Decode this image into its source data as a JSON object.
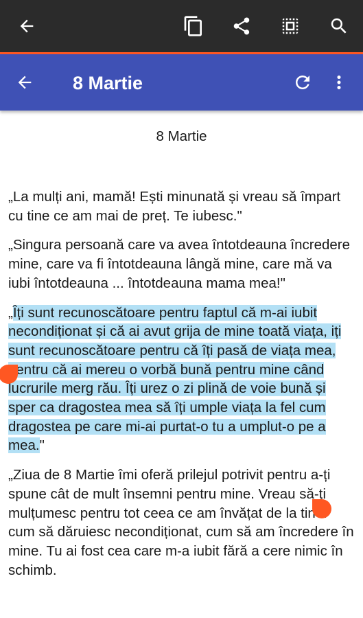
{
  "action_mode": {
    "back_icon": "arrow-back-icon",
    "actions": [
      {
        "name": "copy-icon"
      },
      {
        "name": "share-icon"
      },
      {
        "name": "select-all-icon"
      },
      {
        "name": "web-search-icon"
      }
    ]
  },
  "app_bar": {
    "title": "8 Martie",
    "back_icon": "arrow-back-icon",
    "refresh_icon": "refresh-icon",
    "menu_icon": "more-vert-icon",
    "color": "#3f51b5"
  },
  "content": {
    "title": "8 Martie",
    "p1": "„La mulți ani, mamă! Ești minunată și vreau să împart cu tine ce am mai de preț. Te iubesc.\"",
    "p2": "„Singura persoană care va avea întotdeauna încredere mine, care va fi întotdeauna lângă mine, care mă va iubi întotdeauna ... întotdeauna mama mea!\"",
    "p3_lead": "„",
    "p3_selected": "Îți sunt recunoscătoare pentru faptul că m-ai iubit necondiționat și că ai avut grija de mine toată viața, iți sunt recunoscătoare pentru că îți pasă de viața mea, pentru că ai mereu o vorbă bună pentru mine când lucrurile merg rău. Îți urez o zi plină de voie bună și sper ca dragostea mea să îți umple viața la fel cum dragostea pe care mi-ai purtat-o tu a umplut-o pe a mea.",
    "p3_tail": "\"",
    "p4": "„Ziua de 8 Martie îmi oferă prilejul potrivit pentru a-ți spune cât de mult însemni pentru mine. Vreau să-ți mulțumesc pentru tot ceea ce am învățat de la tine: cum să dăruiesc necondiționat, cum să am încredere în mine. Tu ai fost cea care m-a iubit fără a cere nimic în schimb."
  },
  "colors": {
    "action_bar": "#2b2b2b",
    "accent": "#ff5722",
    "selection": "#b3e0f5"
  }
}
